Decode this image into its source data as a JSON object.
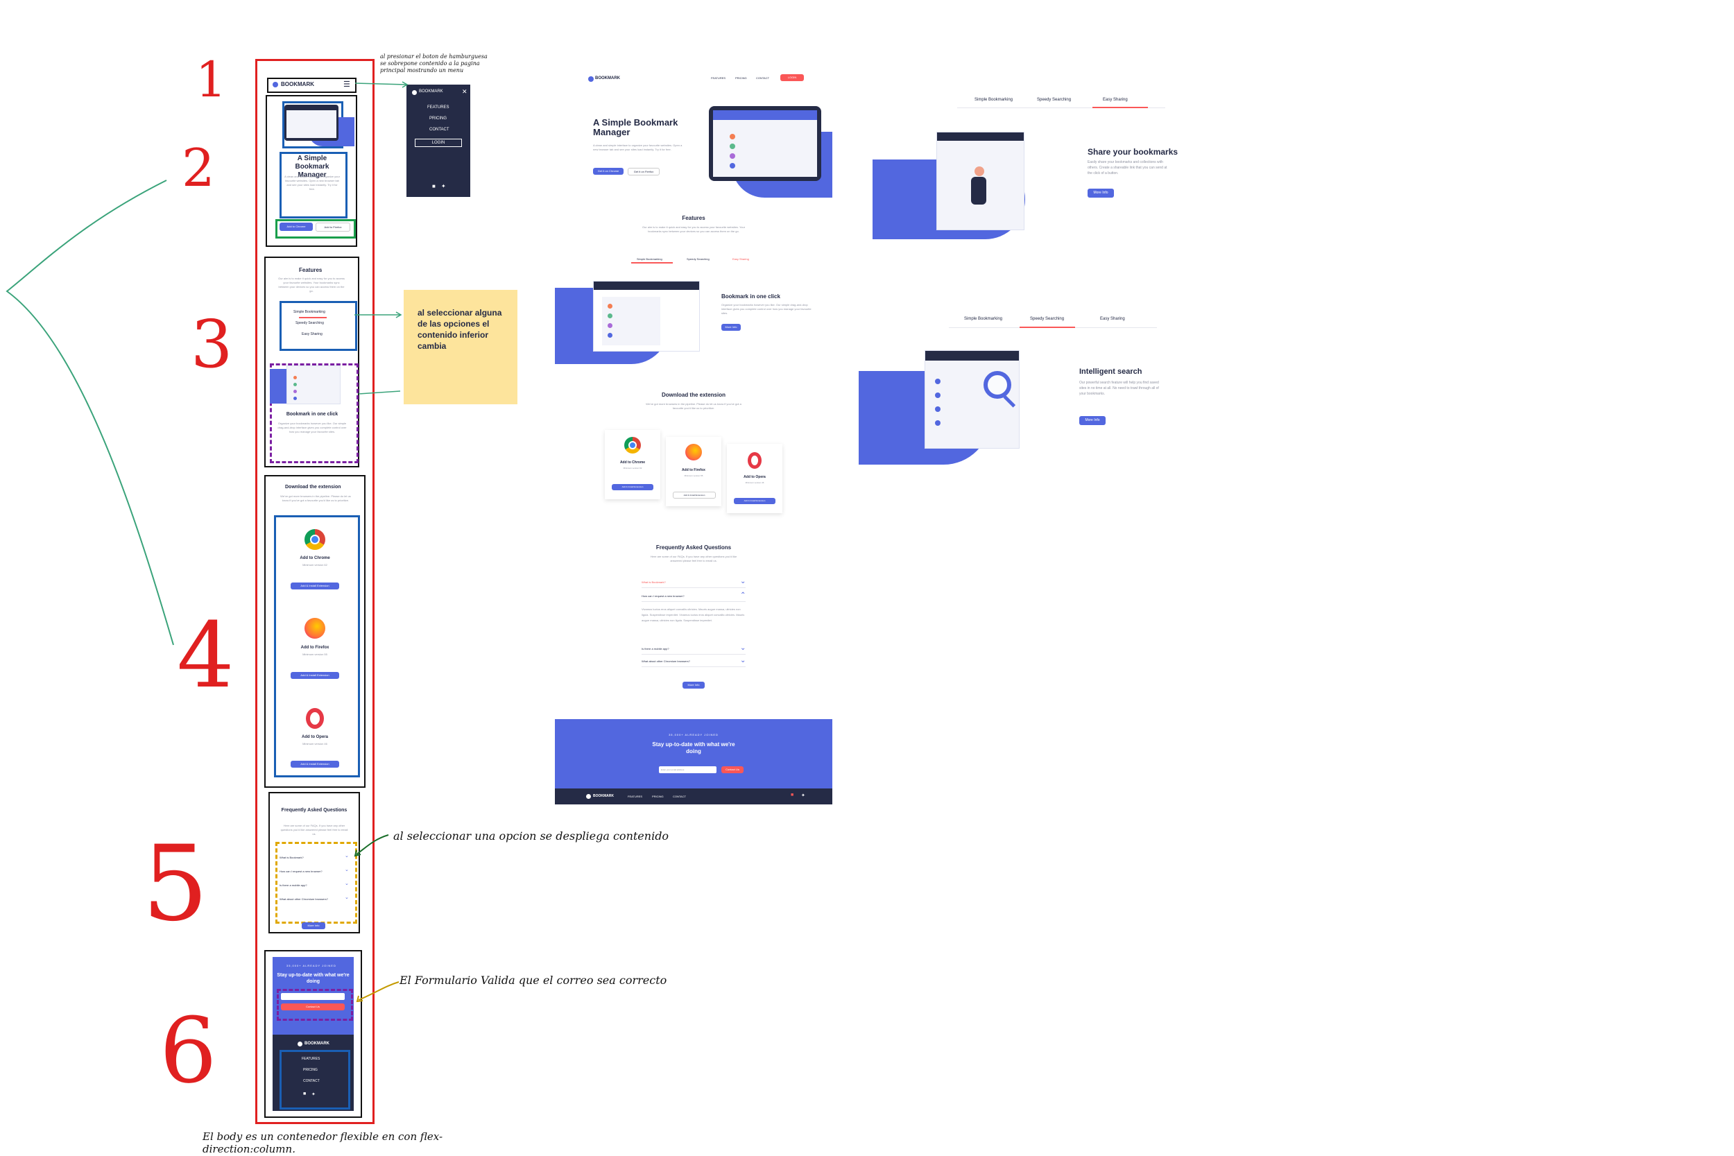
{
  "notes": {
    "hamburger": "al presionar el boton de hamburguesa se sobrepone contenido a la pagina principal mostrando un menu",
    "tabs": "al seleccionar alguna de las opciones el contenido inferior cambia",
    "faq": "al seleccionar una opcion se despliega contenido",
    "form": "El Formulario Valida que el correo sea correcto",
    "body": "El body es un contenedor flexible en con flex-direction:column."
  },
  "section_numbers": [
    "1",
    "2",
    "3",
    "4",
    "5",
    "6"
  ],
  "brand": "BOOKMARK",
  "nav": {
    "features": "FEATURES",
    "pricing": "PRICING",
    "contact": "CONTACT",
    "login": "LOGIN"
  },
  "hero": {
    "title": "A Simple Bookmark Manager",
    "text": "A clean and simple interface to organize your favourite websites. Open a new browser tab and see your sites load instantly. Try it for free.",
    "chrome_btn": "Get it on Chrome",
    "firefox_btn": "Get it on Firefox",
    "chrome_btn_mobile": "Add to Chrome",
    "firefox_btn_mobile": "Add to Firefox"
  },
  "features": {
    "title": "Features",
    "text": "Our aim is to make it quick and easy for you to access your favourite websites. Your bookmarks sync between your devices so you can access them on the go.",
    "tabs": [
      "Simple Bookmarking",
      "Speedy Searching",
      "Easy Sharing"
    ],
    "panels": [
      {
        "title": "Bookmark in one click",
        "text": "Organize your bookmarks however you like. Our simple drag-and-drop interface gives you complete control over how you manage your favourite sites.",
        "btn": "More Info"
      },
      {
        "title": "Intelligent search",
        "text": "Our powerful search feature will help you find saved sites in no time at all. No need to trawl through all of your bookmarks.",
        "btn": "More Info"
      },
      {
        "title": "Share your bookmarks",
        "text": "Easily share your bookmarks and collections with others. Create a shareable link that you can send at the click of a button.",
        "btn": "More Info"
      }
    ]
  },
  "download": {
    "title": "Download the extension",
    "text": "We've got more browsers in the pipeline. Please do let us know if you've got a favourite you'd like us to prioritize.",
    "cards": [
      {
        "name": "Add to Chrome",
        "version": "Minimum version 62",
        "btn": "Add & Install Extension"
      },
      {
        "name": "Add to Firefox",
        "version": "Minimum version 55",
        "btn": "Add & Install Extension"
      },
      {
        "name": "Add to Opera",
        "version": "Minimum version 46",
        "btn": "Add & Install Extension"
      }
    ]
  },
  "faq": {
    "title": "Frequently Asked Questions",
    "text": "Here are some of our FAQs. If you have any other questions you'd like answered please feel free to email us.",
    "items": [
      "What is Bookmark?",
      "How can I request a new browser?",
      "Is there a mobile app?",
      "What about other Chromium browsers?"
    ],
    "answer": "Vivamus luctus eros aliquet convallis ultricies. Mauris augue massa, ultricies non ligula. Suspendisse imperdiet. Vivamus luctus eros aliquet convallis ultricies. Mauris augue massa, ultricies non ligula. Suspendisse imperdiet.",
    "btn": "More Info"
  },
  "contact": {
    "kicker": "35,000+ ALREADY JOINED",
    "title": "Stay up-to-date with what we're doing",
    "placeholder": "Enter your email address",
    "btn": "Contact Us"
  },
  "colors": {
    "accent": "#5267df",
    "red": "#fa5757",
    "navy": "#252b46",
    "annotation_red": "#e02020",
    "note_yellow": "#fde49c",
    "frame_blue": "#1a5fb4"
  }
}
